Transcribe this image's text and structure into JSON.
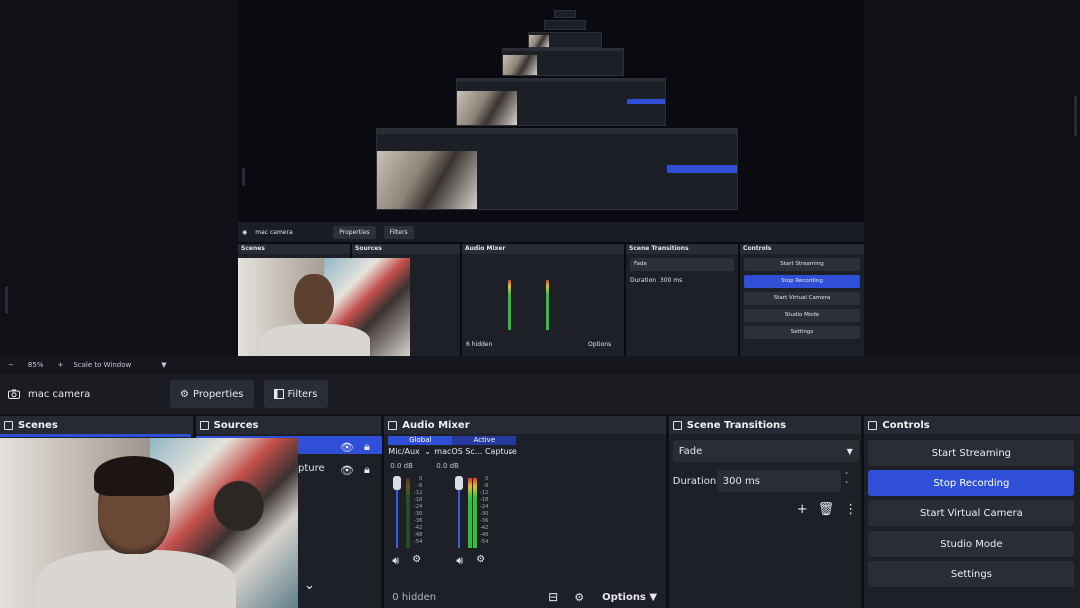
{
  "status_bar": {
    "zoom_minus": "−",
    "zoom_value": "85%",
    "zoom_plus": "+",
    "scale_mode": "Scale to Window",
    "dropdown_caret": "▼"
  },
  "source_toolbar": {
    "source_label": "mac camera",
    "properties_label": "Properties",
    "filters_label": "Filters"
  },
  "docks": {
    "scenes": {
      "title": "Scenes"
    },
    "sources": {
      "title": "Sources",
      "capture_label": "pture"
    },
    "audio_mixer": {
      "title": "Audio Mixer",
      "tabs": [
        "Global",
        "Active"
      ],
      "channels": [
        {
          "name": "Mic/Aux",
          "db": "0.0 dB"
        },
        {
          "name": "macOS Sc... Capture",
          "db": "0.0 dB"
        }
      ],
      "scale": [
        "0",
        "-6",
        "-12",
        "-18",
        "-24",
        "-30",
        "-36",
        "-42",
        "-48",
        "-54",
        "-60"
      ],
      "hidden_label": "0 hidden",
      "options_label": "Options"
    },
    "scene_transitions": {
      "title": "Scene Transitions",
      "transition": "Fade",
      "duration_label": "Duration",
      "duration_value": "300 ms"
    },
    "controls": {
      "title": "Controls",
      "buttons": [
        "Start Streaming",
        "Stop Recording",
        "Start Virtual Camera",
        "Studio Mode",
        "Settings"
      ]
    }
  },
  "mini": {
    "source_label": "mac camera",
    "properties_label": "Properties",
    "filters_label": "Filters",
    "scenes_title": "Scenes",
    "sources_title": "Sources",
    "mixer_title": "Audio Mixer",
    "transitions_title": "Scene Transitions",
    "controls_title": "Controls",
    "transition": "Fade",
    "duration_label": "Duration",
    "duration_value": "300 ms",
    "hidden_label": "6 hidden",
    "options_label": "Options",
    "buttons": [
      "Start Streaming",
      "Stop Recording",
      "Start Virtual Camera",
      "Studio Mode",
      "Settings"
    ]
  },
  "colors": {
    "accent": "#2f4fd6",
    "panel": "#1e2028",
    "button": "#2b2d35"
  }
}
